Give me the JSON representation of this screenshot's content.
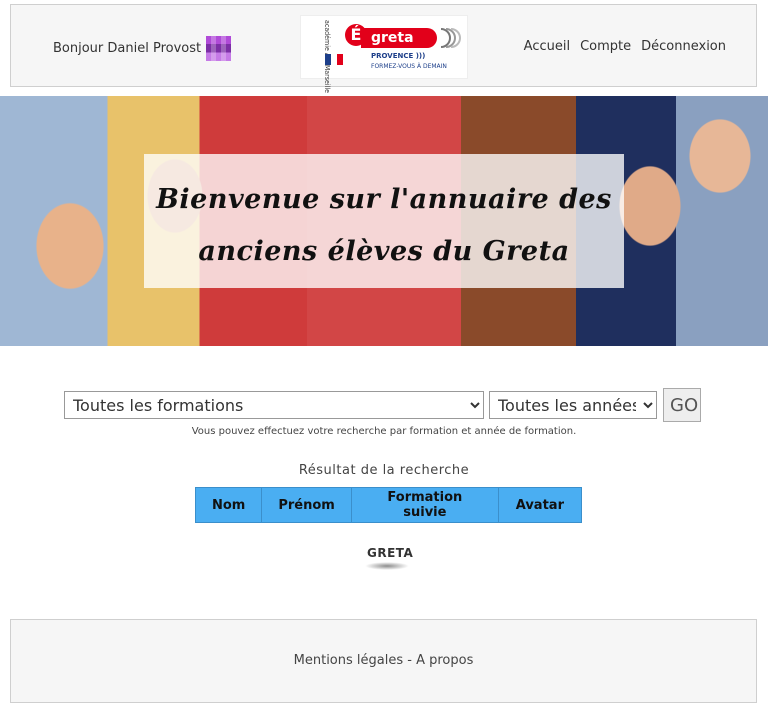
{
  "header": {
    "greeting": "Bonjour Daniel Provost",
    "logo": {
      "academie": "académie Aix-Marseille",
      "brand": "greta",
      "region": "PROVENCE )))",
      "tagline": "FORMEZ-VOUS À DEMAIN"
    },
    "nav": [
      "Accueil",
      "Compte",
      "Déconnexion"
    ]
  },
  "hero": {
    "title_line1": "Bienvenue sur l'annuaire des",
    "title_line2": "anciens élèves du Greta"
  },
  "search": {
    "formation_selected": "Toutes les formations",
    "annee_selected": "Toutes les années",
    "go_label": "GO",
    "hint": "Vous pouvez effectuez votre recherche par formation et année de formation."
  },
  "results": {
    "title": "Résultat de la recherche",
    "columns": [
      "Nom",
      "Prénom",
      "Formation suivie",
      "Avatar"
    ]
  },
  "small_logo": "GRETA",
  "footer": {
    "text": "Mentions légales - A propos"
  },
  "colors": {
    "table_header": "#4aaef2",
    "brand_red": "#e2001a"
  }
}
